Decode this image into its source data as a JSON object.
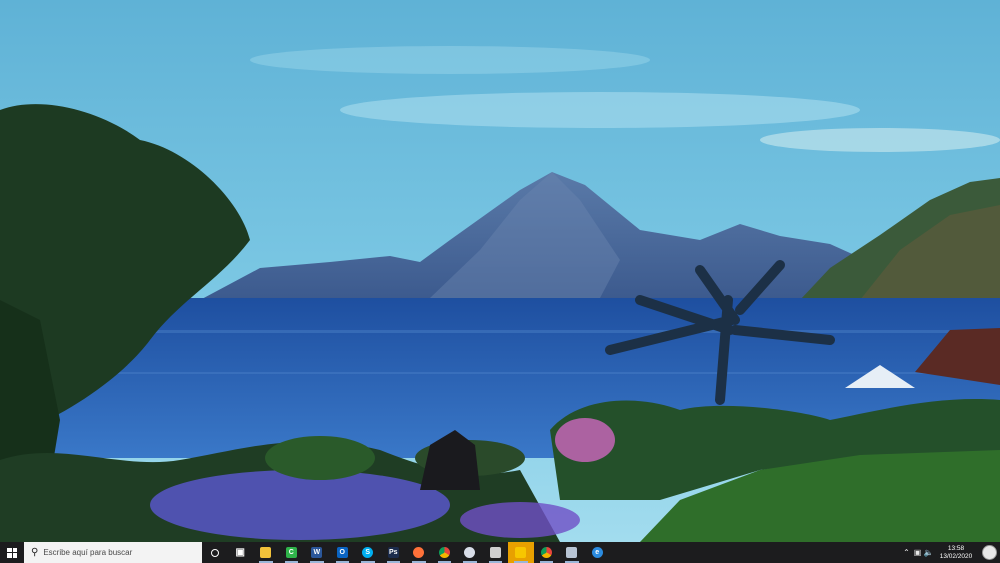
{
  "taskbar": {
    "search_placeholder": "Escribe aquí para buscar",
    "apps": [
      {
        "name": "task-view",
        "color": "#ffffff",
        "glyph": "▣"
      },
      {
        "name": "file-explorer",
        "color": "#f2c23a",
        "glyph": ""
      },
      {
        "name": "camtasia",
        "color": "#2fb34a",
        "glyph": "C"
      },
      {
        "name": "word",
        "color": "#2b579a",
        "glyph": "W"
      },
      {
        "name": "outlook",
        "color": "#0a64c2",
        "glyph": "O"
      },
      {
        "name": "skype",
        "color": "#00aff0",
        "glyph": "S"
      },
      {
        "name": "photoshop",
        "color": "#1c2c4c",
        "glyph": "Ps"
      },
      {
        "name": "firefox",
        "color": "#ff7139",
        "glyph": ""
      },
      {
        "name": "chrome",
        "color": "#e8453c",
        "glyph": ""
      },
      {
        "name": "snipping-tool",
        "color": "#d8dde8",
        "glyph": ""
      },
      {
        "name": "paint-tool",
        "color": "#cfcfcf",
        "glyph": ""
      },
      {
        "name": "sticky-notes",
        "color": "#f7c600",
        "glyph": ""
      },
      {
        "name": "chrome-2",
        "color": "#e8453c",
        "glyph": ""
      },
      {
        "name": "file-manager",
        "color": "#b8c4d4",
        "glyph": ""
      },
      {
        "name": "edge",
        "color": "#2b8be0",
        "glyph": "e"
      }
    ],
    "clock": {
      "time": "13:58",
      "date": "13/02/2020"
    }
  }
}
